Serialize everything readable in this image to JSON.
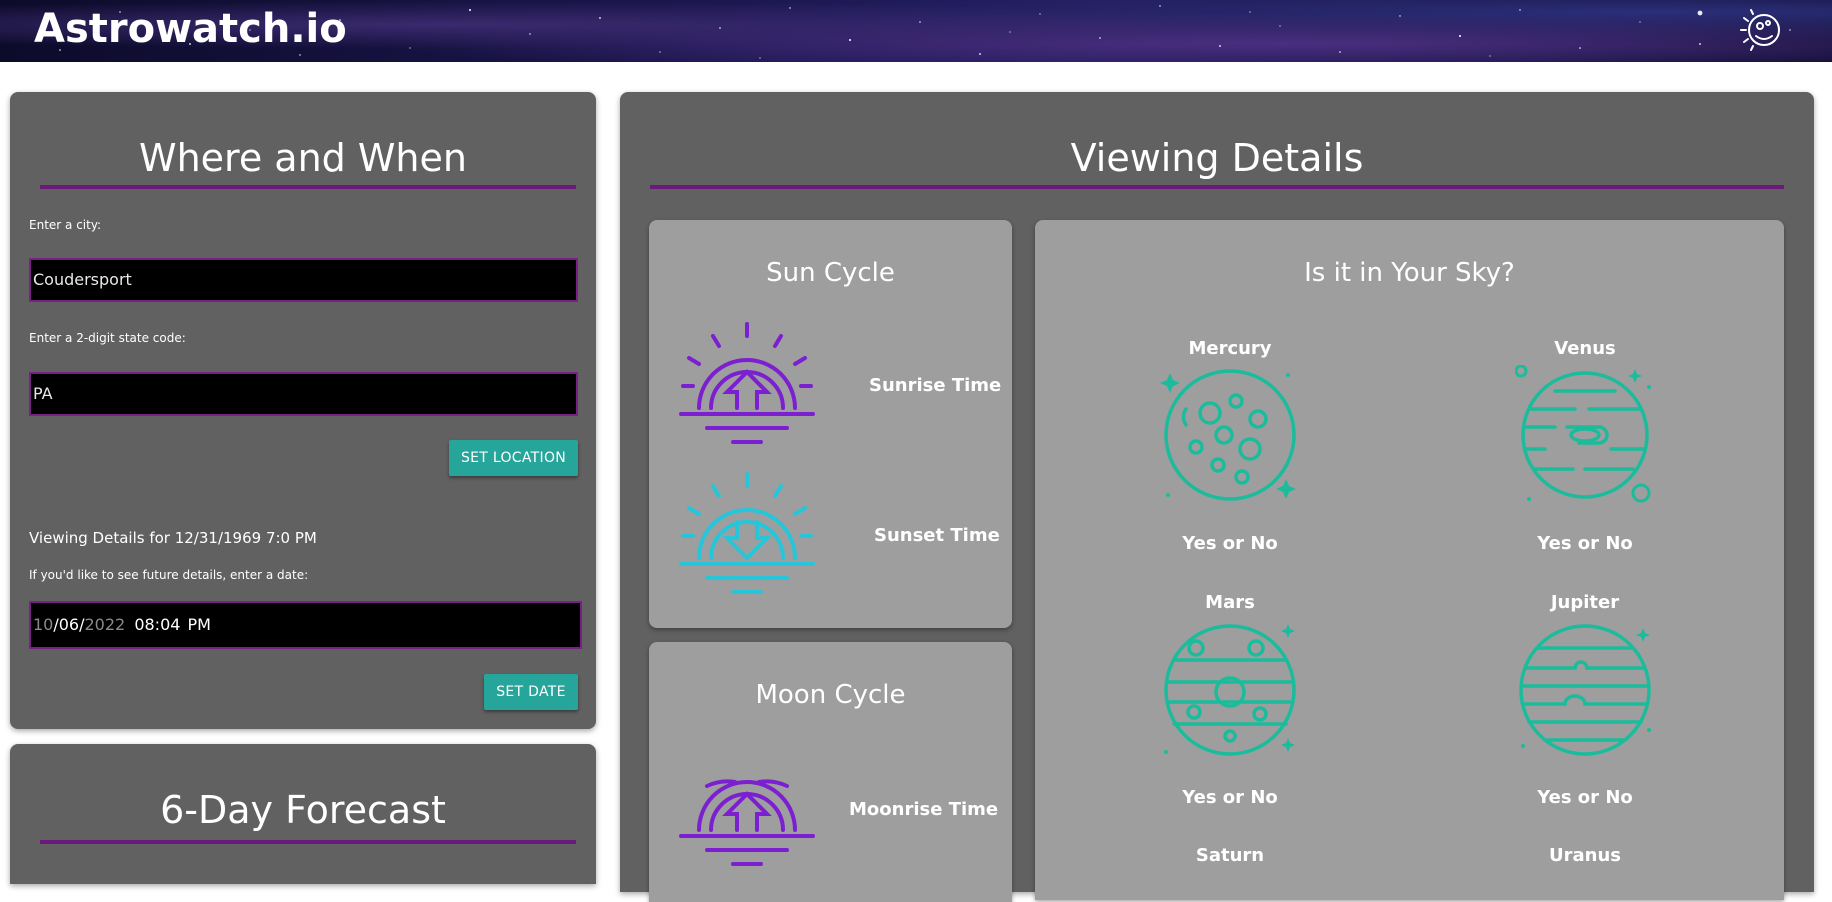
{
  "header": {
    "brand": "Astrowatch.io",
    "logo_icon": "galaxy-eye-icon"
  },
  "where_when": {
    "title": "Where and When",
    "city_label": "Enter a city:",
    "city_value": "Coudersport",
    "state_label": "Enter a 2-digit state code:",
    "state_value": "PA",
    "set_location_button": "SET LOCATION",
    "viewing_details_text": "Viewing Details for 12/31/1969 7:0 PM",
    "future_label": "If you'd like to see future details, enter a date:",
    "date_month": "10",
    "date_sep1": "/",
    "date_day": "06",
    "date_sep2": "/",
    "date_year": "2022",
    "date_time": "08:04",
    "date_ampm": "PM",
    "set_date_button": "SET DATE"
  },
  "forecast": {
    "title": "6-Day Forecast"
  },
  "viewing_details": {
    "title": "Viewing Details",
    "sun_cycle": {
      "title": "Sun Cycle",
      "sunrise_label": "Sunrise Time",
      "sunset_label": "Sunset Time"
    },
    "moon_cycle": {
      "title": "Moon Cycle",
      "moonrise_label": "Moonrise Time"
    },
    "sky": {
      "title": "Is it in Your Sky?",
      "planets": [
        {
          "name": "Mercury",
          "status": "Yes or No"
        },
        {
          "name": "Venus",
          "status": "Yes or No"
        },
        {
          "name": "Mars",
          "status": "Yes or No"
        },
        {
          "name": "Jupiter",
          "status": "Yes or No"
        },
        {
          "name": "Saturn",
          "status": ""
        },
        {
          "name": "Uranus",
          "status": ""
        }
      ]
    }
  },
  "colors": {
    "accent_purple": "#6a1b7a",
    "button_teal": "#26a69a",
    "sunrise_purple": "#7b1fd0",
    "sunset_cyan": "#26c6da",
    "planet_teal": "#1abc9c"
  }
}
